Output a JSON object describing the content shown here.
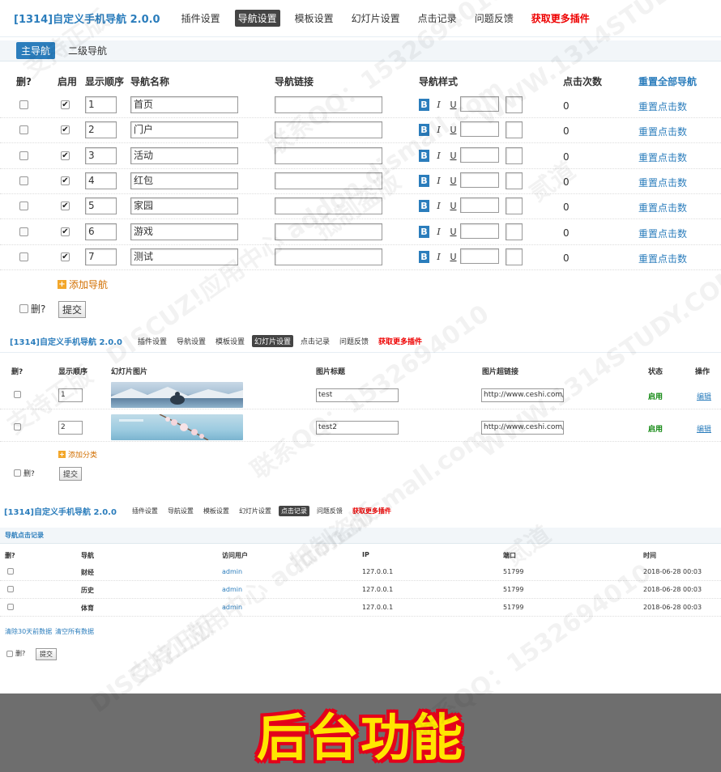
{
  "app": {
    "title": "[1314]自定义手机导航 2.0.0",
    "menu": [
      "插件设置",
      "导航设置",
      "模板设置",
      "幻灯片设置",
      "点击记录",
      "问题反馈",
      "获取更多插件"
    ]
  },
  "nav_settings": {
    "active_menu": "导航设置",
    "subtabs": [
      "主导航",
      "二级导航"
    ],
    "active_subtab": "主导航",
    "headers": {
      "del": "删?",
      "enabled": "启用",
      "order": "显示顺序",
      "name": "导航名称",
      "link": "导航链接",
      "style": "导航样式",
      "clicks": "点击次数",
      "reset_all": "重置全部导航"
    },
    "style_buttons": {
      "bold": "B",
      "italic": "I",
      "underline": "U"
    },
    "rows": [
      {
        "order": "1",
        "name": "首页",
        "link": "",
        "clicks": "0",
        "reset": "重置点击数",
        "enabled": true
      },
      {
        "order": "2",
        "name": "门户",
        "link": "",
        "clicks": "0",
        "reset": "重置点击数",
        "enabled": true
      },
      {
        "order": "3",
        "name": "活动",
        "link": "",
        "clicks": "0",
        "reset": "重置点击数",
        "enabled": true
      },
      {
        "order": "4",
        "name": "红包",
        "link": "",
        "clicks": "0",
        "reset": "重置点击数",
        "enabled": true
      },
      {
        "order": "5",
        "name": "家园",
        "link": "",
        "clicks": "0",
        "reset": "重置点击数",
        "enabled": true
      },
      {
        "order": "6",
        "name": "游戏",
        "link": "",
        "clicks": "0",
        "reset": "重置点击数",
        "enabled": true
      },
      {
        "order": "7",
        "name": "测试",
        "link": "",
        "clicks": "0",
        "reset": "重置点击数",
        "enabled": true
      }
    ],
    "add_label": "添加导航",
    "del_label": "删?",
    "submit_label": "提交"
  },
  "slide_settings": {
    "active_menu": "幻灯片设置",
    "headers": {
      "del": "删?",
      "order": "显示顺序",
      "image": "幻灯片图片",
      "title": "图片标题",
      "link": "图片超链接",
      "status": "状态",
      "action": "操作"
    },
    "rows": [
      {
        "order": "1",
        "title": "test",
        "link": "http://www.ceshi.com/D",
        "status": "启用",
        "action": "编辑"
      },
      {
        "order": "2",
        "title": "test2",
        "link": "http://www.ceshi.com/D",
        "status": "启用",
        "action": "编辑"
      }
    ],
    "add_label": "添加分类",
    "del_label": "删?",
    "submit_label": "提交"
  },
  "click_records": {
    "active_menu": "点击记录",
    "section_title": "导航点击记录",
    "headers": {
      "del": "删?",
      "nav": "导航",
      "user": "访问用户",
      "ip": "IP",
      "port": "端口",
      "time": "时间"
    },
    "rows": [
      {
        "nav": "财经",
        "user": "admin",
        "ip": "127.0.0.1",
        "port": "51799",
        "time": "2018-06-28 00:03"
      },
      {
        "nav": "历史",
        "user": "admin",
        "ip": "127.0.0.1",
        "port": "51799",
        "time": "2018-06-28 00:03"
      },
      {
        "nav": "体育",
        "user": "admin",
        "ip": "127.0.0.1",
        "port": "51799",
        "time": "2018-06-28 00:03"
      }
    ],
    "clear_30": "清除30天前数据",
    "clear_all": "清空所有数据",
    "del_label": "删?",
    "submit_label": "提交"
  },
  "banner": {
    "text": "后台功能"
  },
  "watermark": [
    "支持正版",
    "联系QQ：1532694010",
    "WWW.1314STUDY.COM",
    "DISCUZ!应用中心 addon.dismall.com",
    "抵制盗版",
    "贰道"
  ],
  "colors": {
    "accent": "#2b7dbc",
    "red_link": "#e00000",
    "banner_bg": "#6e6e6e",
    "banner_text": "#ffe600",
    "banner_outline": "#e3001b",
    "status_green": "#118811"
  }
}
